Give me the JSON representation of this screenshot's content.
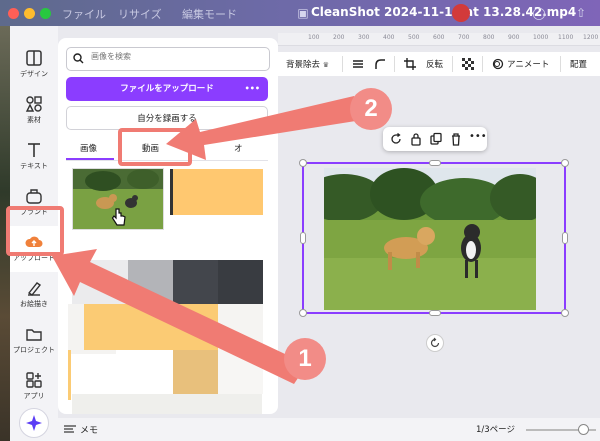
{
  "window": {
    "title": "CleanShot 2024-11-18 at 13.28.42.mp4",
    "menu_file": "ファイル",
    "menu_resize": "リサイズ",
    "menu_edit_mode": "編集モード"
  },
  "nav": {
    "items": [
      {
        "label": "デザイン",
        "icon": "layout-icon"
      },
      {
        "label": "素材",
        "icon": "shapes-icon"
      },
      {
        "label": "テキスト",
        "icon": "text-icon"
      },
      {
        "label": "ブランド",
        "icon": "brand-icon"
      },
      {
        "label": "アップロード",
        "icon": "upload-cloud-icon"
      },
      {
        "label": "お絵描き",
        "icon": "draw-icon"
      },
      {
        "label": "プロジェクト",
        "icon": "folder-icon"
      },
      {
        "label": "アプリ",
        "icon": "apps-icon"
      }
    ],
    "active": "アップロード"
  },
  "panel": {
    "search_placeholder": "画像を検索",
    "upload_label": "ファイルをアップロード",
    "more_label": "•••",
    "record_label": "自分を録画する",
    "tabs": [
      "画像",
      "動画",
      "オ"
    ]
  },
  "toolbar": {
    "bg_remove": "背景除去",
    "flip": "反転",
    "animate": "アニメート",
    "position": "配置"
  },
  "ruler": [
    "100",
    "200",
    "300",
    "400",
    "500",
    "600",
    "700",
    "800",
    "900",
    "1000",
    "1100",
    "1200"
  ],
  "bottom": {
    "notes": "メモ",
    "page": "1/3ページ"
  },
  "annotations": {
    "badge_1": "1",
    "badge_2": "2"
  },
  "colors": {
    "accent": "#8b3dff",
    "annotation": "#f07b73"
  }
}
